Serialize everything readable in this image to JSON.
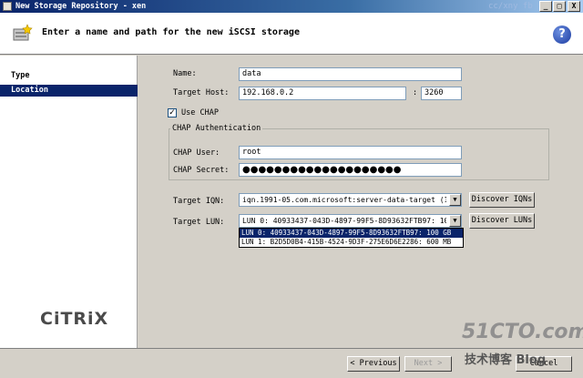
{
  "window": {
    "title": "New Storage Repository - xen",
    "watermark": "cc/xny fb",
    "controls": [
      "_",
      "□",
      "X"
    ]
  },
  "header": {
    "title": "Enter a name and path for the new iSCSI storage",
    "help_label": "?"
  },
  "sidebar": {
    "items": [
      {
        "label": "Type",
        "selected": false
      },
      {
        "label": "Location",
        "selected": true
      }
    ],
    "logo": "CiTRiX"
  },
  "form": {
    "name_label": "Name:",
    "name_value": "data",
    "target_host_label": "Target Host:",
    "target_host_value": "192.168.0.2",
    "port_separator": ":",
    "port_value": "3260",
    "use_chap_label": "Use CHAP",
    "use_chap_checked": "✓",
    "chap_group_title": "CHAP Authentication",
    "chap_user_label": "CHAP User:",
    "chap_user_value": "root",
    "chap_secret_label": "CHAP Secret:",
    "chap_secret_value": "●●●●●●●●●●●●●●●●●●●●",
    "target_iqn_label": "Target IQN:",
    "target_iqn_value": "iqn.1991-05.com.microsoft:server-data-target (19:",
    "discover_iqns_label": "Discover IQNs",
    "target_lun_label": "Target LUN:",
    "target_lun_value": "LUN 0: 40933437-043D-4897-99F5-8D93632FTB97: 100",
    "discover_luns_label": "Discover LUNs",
    "lun_options": [
      {
        "label": "LUN 0: 40933437-043D-4897-99F5-8D93632FTB97: 100 GB",
        "selected": true
      },
      {
        "label": "LUN 1: B2D5D0B4-415B-4524-9D3F-275E6D6E2286: 600 MB",
        "selected": false
      }
    ]
  },
  "footer": {
    "previous_label": "< Previous",
    "next_label": "Next >",
    "cancel_label": "Cancel",
    "watermark_main": "51CTO.com",
    "watermark_sub": "技术博客  Blog"
  }
}
